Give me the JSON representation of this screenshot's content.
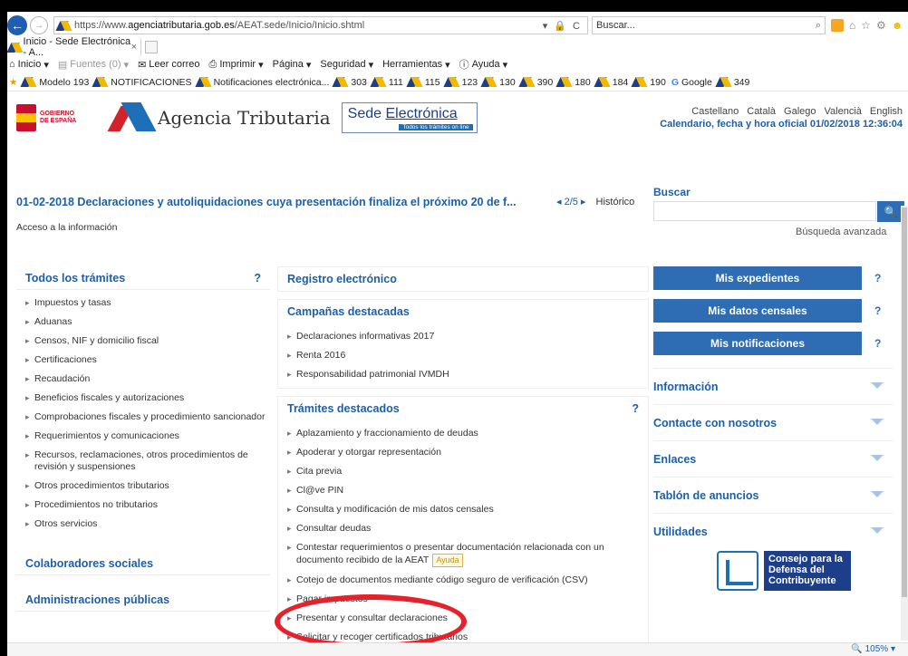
{
  "window": {
    "minimize": "—",
    "restore": "▢",
    "close": "✕"
  },
  "address": {
    "url_prefix": "https://www.",
    "url_domain": "agenciatributaria.gob.es",
    "url_path": "/AEAT.sede/Inicio/Inicio.shtml",
    "url_icons": "▾ 🔒 C",
    "search_placeholder": "Buscar...",
    "search_icon": "⌕"
  },
  "tab": {
    "title": "Inicio - Sede Electrónica - A...",
    "close": "×"
  },
  "commands": [
    {
      "label": "Inicio",
      "icon": "home-icon",
      "caret": "▾",
      "dim": false
    },
    {
      "label": "Fuentes (0)",
      "icon": "rss-icon",
      "caret": "▾",
      "dim": true
    },
    {
      "label": "Leer correo",
      "icon": "mail-icon",
      "caret": "",
      "dim": false
    },
    {
      "label": "Imprimir",
      "icon": "print-icon",
      "caret": "▾",
      "dim": false
    },
    {
      "label": "Página",
      "icon": "",
      "caret": "▾",
      "dim": false
    },
    {
      "label": "Seguridad",
      "icon": "",
      "caret": "▾",
      "dim": false
    },
    {
      "label": "Herramientas",
      "icon": "",
      "caret": "▾",
      "dim": false
    },
    {
      "label": "Ayuda",
      "icon": "help-icon",
      "caret": "▾",
      "dim": false
    }
  ],
  "favorites": [
    "Modelo 193",
    "NOTIFICACIONES",
    "Notificaciones electrónica...",
    "303",
    "111",
    "115",
    "123",
    "130",
    "390",
    "180",
    "184",
    "190",
    "Google",
    "349"
  ],
  "header": {
    "gobierno": "GOBIERNO\nDE ESPAÑA",
    "agency_name": "Agencia Tributaria",
    "sede_title_1": "Sede ",
    "sede_title_2": "Electrónica",
    "sede_sub": "Todos los trámites on line",
    "languages": [
      "Castellano",
      "Català",
      "Galego",
      "Valencià",
      "English"
    ],
    "calendar": "Calendario, fecha y hora oficial 01/02/2018 12:36:04"
  },
  "news": {
    "title": "01-02-2018  Declaraciones y autoliquidaciones cuya presentación finaliza el próximo 20 de f...",
    "counter": "◂ 2/5 ▸",
    "historico": "Histórico",
    "access": "Acceso a la información"
  },
  "search": {
    "label": "Buscar",
    "button": "🔍",
    "advanced": "Búsqueda avanzada"
  },
  "left": {
    "todos_title": "Todos los trámites",
    "todos_help": "?",
    "todos_items": [
      "Impuestos y tasas",
      "Aduanas",
      "Censos, NIF y domicilio fiscal",
      "Certificaciones",
      "Recaudación",
      "Beneficios fiscales y autorizaciones",
      "Comprobaciones fiscales y procedimiento sancionador",
      "Requerimientos y comunicaciones",
      "Recursos, reclamaciones, otros procedimientos de revisión y suspensiones",
      "Otros procedimientos tributarios",
      "Procedimientos no tributarios",
      "Otros servicios"
    ],
    "colaboradores": "Colaboradores sociales",
    "administraciones": "Administraciones públicas"
  },
  "middle": {
    "registro": "Registro electrónico",
    "campanas_title": "Campañas destacadas",
    "campanas_items": [
      "Declaraciones informativas 2017",
      "Renta 2016",
      "Responsabilidad patrimonial IVMDH"
    ],
    "tramites_title": "Trámites destacados",
    "tramites_help": "?",
    "tramites_items": [
      "Aplazamiento y fraccionamiento de deudas",
      "Apoderar y otorgar representación",
      "Cita previa",
      "Cl@ve PIN",
      "Consulta y modificación de mis datos censales",
      "Consultar deudas",
      "Contestar requerimientos o presentar documentación relacionada con un documento recibido de la AEAT",
      "Cotejo de documentos mediante código seguro de verificación (CSV)",
      "Pagar impuestos",
      "Presentar y consultar declaraciones",
      "Solicitar y recoger certificados tributarios"
    ],
    "ayuda_badge": "Ayuda"
  },
  "right": {
    "buttons": [
      {
        "label": "Mis expedientes",
        "help": "?"
      },
      {
        "label": "Mis datos censales",
        "help": "?"
      },
      {
        "label": "Mis notificaciones",
        "help": "?"
      }
    ],
    "accordion": [
      "Información",
      "Contacte con nosotros",
      "Enlaces",
      "Tablón de anuncios",
      "Utilidades"
    ],
    "consejo": "Consejo para la Defensa del Contribuyente"
  },
  "status": {
    "zoom": "🔍 105%  ▾"
  },
  "colors": {
    "brand_blue": "#2e6db4",
    "link_blue": "#1d5fa8",
    "annotation_red": "#e5222b"
  }
}
